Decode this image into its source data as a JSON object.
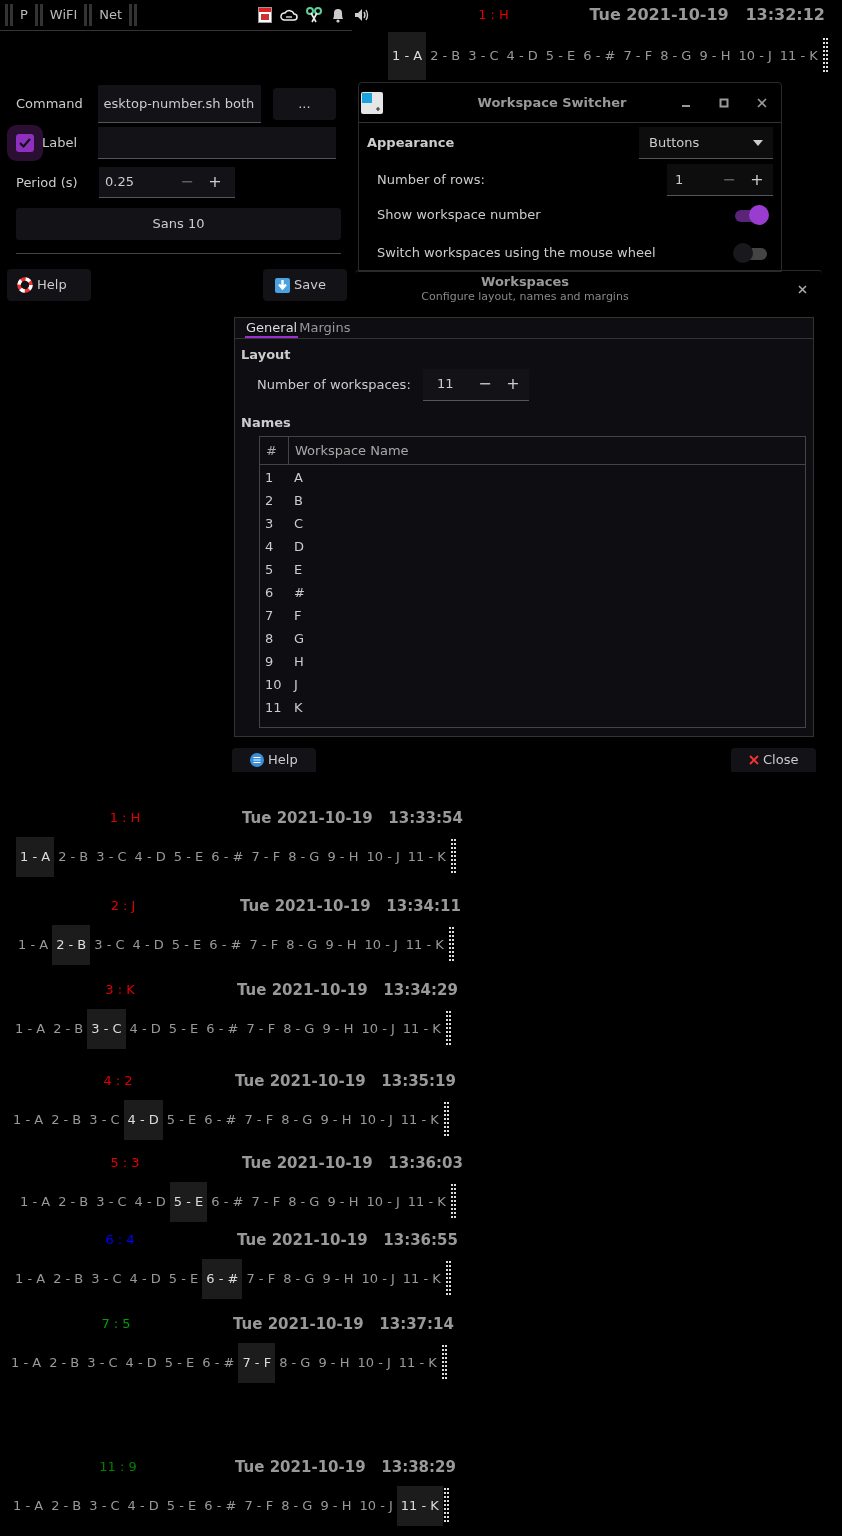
{
  "top_panel": {
    "launchers": [
      {
        "label": "P"
      },
      {
        "label": "WiFI"
      },
      {
        "label": "Net"
      }
    ],
    "workspace_label": {
      "text": "1 : H",
      "color": "#e00000"
    },
    "datetime": "Tue 2021-10-19   13:32:12"
  },
  "top_switcher": {
    "workspaces": [
      {
        "label": "1 - A",
        "selected": true
      },
      {
        "label": "2 - B",
        "selected": false
      },
      {
        "label": "3 - C",
        "selected": false
      },
      {
        "label": "4 - D",
        "selected": false
      },
      {
        "label": "5 - E",
        "selected": false
      },
      {
        "label": "6 - #",
        "selected": false
      },
      {
        "label": "7 - F",
        "selected": false
      },
      {
        "label": "8 - G",
        "selected": false
      },
      {
        "label": "9 - H",
        "selected": false
      },
      {
        "label": "10 - J",
        "selected": false
      },
      {
        "label": "11 - K",
        "selected": false
      }
    ]
  },
  "monitor_dialog": {
    "command_label": "Command",
    "command_value": "esktop-number.sh both",
    "browse_button": "...",
    "label_checkbox": {
      "label": "Label",
      "checked": true
    },
    "period_label": "Period (s)",
    "period_value": "0.25",
    "minus": "−",
    "plus": "+",
    "font_button": "Sans 10",
    "help_button": "Help",
    "save_button": "Save"
  },
  "switcher_window": {
    "title": "Workspace Switcher",
    "appearance_label": "Appearance",
    "appearance_value": "Buttons",
    "rows_label": "Number of rows:",
    "rows_value": "1",
    "minus": "−",
    "plus": "+",
    "toggles": [
      {
        "label": "Show workspace number",
        "on": true
      },
      {
        "label": "Switch workspaces using the mouse wheel",
        "on": false
      }
    ]
  },
  "workspaces_dialog": {
    "title": "Workspaces",
    "subtitle": "Configure layout, names and margins",
    "tabs": [
      {
        "label": "General",
        "selected": true
      },
      {
        "label": "Margins",
        "selected": false
      }
    ],
    "layout_heading": "Layout",
    "count_label": "Number of workspaces:",
    "count_value": "11",
    "minus": "−",
    "plus": "+",
    "names_heading": "Names",
    "columns": [
      "#",
      "Workspace Name"
    ],
    "rows": [
      {
        "number": "1",
        "name": "A"
      },
      {
        "number": "2",
        "name": "B"
      },
      {
        "number": "3",
        "name": "C"
      },
      {
        "number": "4",
        "name": "D"
      },
      {
        "number": "5",
        "name": "E"
      },
      {
        "number": "6",
        "name": "#"
      },
      {
        "number": "7",
        "name": "F"
      },
      {
        "number": "8",
        "name": "G"
      },
      {
        "number": "9",
        "name": "H"
      },
      {
        "number": "10",
        "name": "J"
      },
      {
        "number": "11",
        "name": "K"
      }
    ],
    "help_button": "Help",
    "close_button": "Close"
  },
  "snapshots": [
    {
      "label": "1 : H",
      "color": "#e00000",
      "datetime": "Tue 2021-10-19   13:33:54",
      "workspaces": [
        {
          "label": "1 - A",
          "selected": true
        },
        {
          "label": "2 - B",
          "selected": false
        },
        {
          "label": "3 - C",
          "selected": false
        },
        {
          "label": "4 - D",
          "selected": false
        },
        {
          "label": "5 - E",
          "selected": false
        },
        {
          "label": "6 - #",
          "selected": false
        },
        {
          "label": "7 - F",
          "selected": false
        },
        {
          "label": "8 - G",
          "selected": false
        },
        {
          "label": "9 - H",
          "selected": false
        },
        {
          "label": "10 - J",
          "selected": false
        },
        {
          "label": "11 - K",
          "selected": false
        }
      ]
    },
    {
      "label": "2 : J",
      "color": "#e00000",
      "datetime": "Tue 2021-10-19   13:34:11",
      "workspaces": [
        {
          "label": "1 - A",
          "selected": false
        },
        {
          "label": "2 - B",
          "selected": true
        },
        {
          "label": "3 - C",
          "selected": false
        },
        {
          "label": "4 - D",
          "selected": false
        },
        {
          "label": "5 - E",
          "selected": false
        },
        {
          "label": "6 - #",
          "selected": false
        },
        {
          "label": "7 - F",
          "selected": false
        },
        {
          "label": "8 - G",
          "selected": false
        },
        {
          "label": "9 - H",
          "selected": false
        },
        {
          "label": "10 - J",
          "selected": false
        },
        {
          "label": "11 - K",
          "selected": false
        }
      ]
    },
    {
      "label": "3 : K",
      "color": "#e00000",
      "datetime": "Tue 2021-10-19   13:34:29",
      "workspaces": [
        {
          "label": "1 - A",
          "selected": false
        },
        {
          "label": "2 - B",
          "selected": false
        },
        {
          "label": "3 - C",
          "selected": true
        },
        {
          "label": "4 - D",
          "selected": false
        },
        {
          "label": "5 - E",
          "selected": false
        },
        {
          "label": "6 - #",
          "selected": false
        },
        {
          "label": "7 - F",
          "selected": false
        },
        {
          "label": "8 - G",
          "selected": false
        },
        {
          "label": "9 - H",
          "selected": false
        },
        {
          "label": "10 - J",
          "selected": false
        },
        {
          "label": "11 - K",
          "selected": false
        }
      ]
    },
    {
      "label": "4 : 2",
      "color": "#e00000",
      "datetime": "Tue 2021-10-19   13:35:19",
      "workspaces": [
        {
          "label": "1 - A",
          "selected": false
        },
        {
          "label": "2 - B",
          "selected": false
        },
        {
          "label": "3 - C",
          "selected": false
        },
        {
          "label": "4 - D",
          "selected": true
        },
        {
          "label": "5 - E",
          "selected": false
        },
        {
          "label": "6 - #",
          "selected": false
        },
        {
          "label": "7 - F",
          "selected": false
        },
        {
          "label": "8 - G",
          "selected": false
        },
        {
          "label": "9 - H",
          "selected": false
        },
        {
          "label": "10 - J",
          "selected": false
        },
        {
          "label": "11 - K",
          "selected": false
        }
      ]
    },
    {
      "label": "5 : 3",
      "color": "#e00000",
      "datetime": "Tue 2021-10-19   13:36:03",
      "workspaces": [
        {
          "label": "1 - A",
          "selected": false
        },
        {
          "label": "2 - B",
          "selected": false
        },
        {
          "label": "3 - C",
          "selected": false
        },
        {
          "label": "4 - D",
          "selected": false
        },
        {
          "label": "5 - E",
          "selected": true
        },
        {
          "label": "6 - #",
          "selected": false
        },
        {
          "label": "7 - F",
          "selected": false
        },
        {
          "label": "8 - G",
          "selected": false
        },
        {
          "label": "9 - H",
          "selected": false
        },
        {
          "label": "10 - J",
          "selected": false
        },
        {
          "label": "11 - K",
          "selected": false
        }
      ]
    },
    {
      "label": "6 : 4",
      "color": "#0000ff",
      "datetime": "Tue 2021-10-19   13:36:55",
      "workspaces": [
        {
          "label": "1 - A",
          "selected": false
        },
        {
          "label": "2 - B",
          "selected": false
        },
        {
          "label": "3 - C",
          "selected": false
        },
        {
          "label": "4 - D",
          "selected": false
        },
        {
          "label": "5 - E",
          "selected": false
        },
        {
          "label": "6 - #",
          "selected": true
        },
        {
          "label": "7 - F",
          "selected": false
        },
        {
          "label": "8 - G",
          "selected": false
        },
        {
          "label": "9 - H",
          "selected": false
        },
        {
          "label": "10 - J",
          "selected": false
        },
        {
          "label": "11 - K",
          "selected": false
        }
      ]
    },
    {
      "label": "7 : 5",
      "color": "#00a000",
      "datetime": "Tue 2021-10-19   13:37:14",
      "workspaces": [
        {
          "label": "1 - A",
          "selected": false
        },
        {
          "label": "2 - B",
          "selected": false
        },
        {
          "label": "3 - C",
          "selected": false
        },
        {
          "label": "4 - D",
          "selected": false
        },
        {
          "label": "5 - E",
          "selected": false
        },
        {
          "label": "6 - #",
          "selected": false
        },
        {
          "label": "7 - F",
          "selected": true
        },
        {
          "label": "8 - G",
          "selected": false
        },
        {
          "label": "9 - H",
          "selected": false
        },
        {
          "label": "10 - J",
          "selected": false
        },
        {
          "label": "11 - K",
          "selected": false
        }
      ]
    },
    {
      "label": "11 : 9",
      "color": "#008000",
      "datetime": "Tue 2021-10-19   13:38:29",
      "workspaces": [
        {
          "label": "1 - A",
          "selected": false
        },
        {
          "label": "2 - B",
          "selected": false
        },
        {
          "label": "3 - C",
          "selected": false
        },
        {
          "label": "4 - D",
          "selected": false
        },
        {
          "label": "5 - E",
          "selected": false
        },
        {
          "label": "6 - #",
          "selected": false
        },
        {
          "label": "7 - F",
          "selected": false
        },
        {
          "label": "8 - G",
          "selected": false
        },
        {
          "label": "9 - H",
          "selected": false
        },
        {
          "label": "10 - J",
          "selected": false
        },
        {
          "label": "11 - K",
          "selected": true
        }
      ]
    }
  ]
}
